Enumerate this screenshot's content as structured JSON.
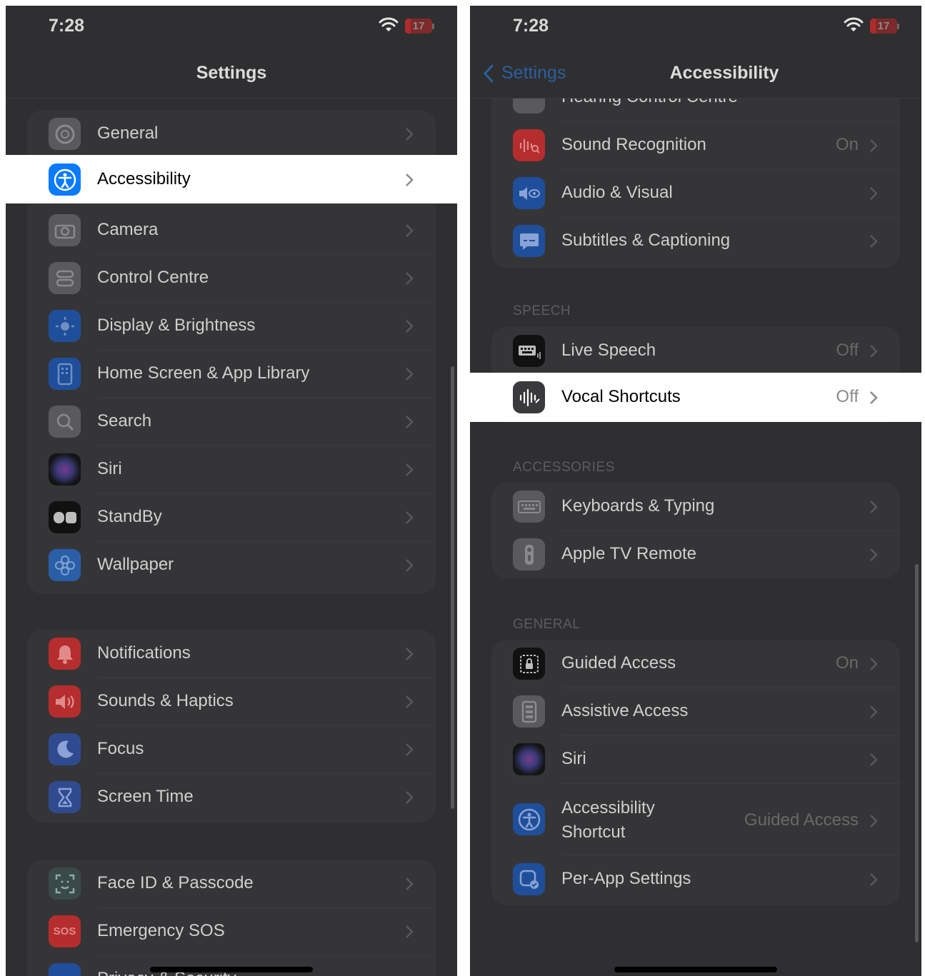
{
  "left": {
    "status": {
      "time": "7:28",
      "battery": "17"
    },
    "title": "Settings",
    "group1": [
      {
        "label": "General",
        "icon": "gear-icon",
        "color": "#5a5a5c"
      },
      {
        "label": "Accessibility",
        "icon": "accessibility-icon",
        "color": "#0a7aff"
      },
      {
        "label": "Camera",
        "icon": "camera-icon",
        "color": "#5a5a5c"
      },
      {
        "label": "Control Centre",
        "icon": "toggles-icon",
        "color": "#5a5a5c"
      },
      {
        "label": "Display & Brightness",
        "icon": "sun-icon",
        "color": "#1f4f9a"
      },
      {
        "label": "Home Screen & App Library",
        "icon": "phone-grid-icon",
        "color": "#1f4f9a"
      },
      {
        "label": "Search",
        "icon": "magnifier-icon",
        "color": "#5a5a5c"
      },
      {
        "label": "Siri",
        "icon": "siri-icon",
        "color": "#222222"
      },
      {
        "label": "StandBy",
        "icon": "standby-icon",
        "color": "#111111"
      },
      {
        "label": "Wallpaper",
        "icon": "flower-icon",
        "color": "#2a5fa8"
      }
    ],
    "group2": [
      {
        "label": "Notifications",
        "icon": "bell-icon",
        "color": "#b52d2d"
      },
      {
        "label": "Sounds & Haptics",
        "icon": "speaker-icon",
        "color": "#b52d2d"
      },
      {
        "label": "Focus",
        "icon": "moon-icon",
        "color": "#2f4a8f"
      },
      {
        "label": "Screen Time",
        "icon": "hourglass-icon",
        "color": "#2f4a8f"
      }
    ],
    "group3": [
      {
        "label": "Face ID & Passcode",
        "icon": "faceid-icon",
        "color": "#2f5f4a"
      },
      {
        "label": "Emergency SOS",
        "icon": "sos-icon",
        "sos": "SOS",
        "color": "#b52d2d"
      },
      {
        "label": "Privacy & Security",
        "icon": "hand-icon",
        "color": "#1f4f9a"
      }
    ]
  },
  "right": {
    "status": {
      "time": "7:28",
      "battery": "17"
    },
    "back_label": "Settings",
    "title": "Accessibility",
    "hearing": [
      {
        "label": "Hearing Control Centre",
        "icon": "toggle-icon",
        "color": "#5a5a5c"
      },
      {
        "label": "Sound Recognition",
        "value": "On",
        "icon": "waveform-search-icon",
        "color": "#b52d2d"
      },
      {
        "label": "Audio & Visual",
        "icon": "speaker-eye-icon",
        "color": "#1f4f9a"
      },
      {
        "label": "Subtitles & Captioning",
        "icon": "caption-bubble-icon",
        "color": "#1f4f9a"
      }
    ],
    "speech_header": "SPEECH",
    "speech": [
      {
        "label": "Live Speech",
        "value": "Off",
        "icon": "keyboard-wave-icon",
        "color": "#111111"
      },
      {
        "label": "Vocal Shortcuts",
        "value": "Off",
        "icon": "waveform-icon",
        "color": "#3a3a3c"
      }
    ],
    "accessories_header": "ACCESSORIES",
    "accessories": [
      {
        "label": "Keyboards & Typing",
        "icon": "keyboard-icon",
        "color": "#5a5a5c"
      },
      {
        "label": "Apple TV Remote",
        "icon": "remote-icon",
        "color": "#5a5a5c"
      }
    ],
    "general_header": "GENERAL",
    "general": [
      {
        "label": "Guided Access",
        "value": "On",
        "icon": "lock-frame-icon",
        "color": "#111111"
      },
      {
        "label": "Assistive Access",
        "icon": "phone-grid-icon",
        "color": "#5a5a5c"
      },
      {
        "label": "Siri",
        "icon": "siri-icon",
        "color": "#222222"
      },
      {
        "label_line1": "Accessibility",
        "label_line2": "Shortcut",
        "value": "Guided Access",
        "icon": "accessibility-icon",
        "color": "#1f4f9a"
      },
      {
        "label": "Per-App Settings",
        "icon": "app-check-icon",
        "color": "#1f4f9a"
      }
    ]
  }
}
